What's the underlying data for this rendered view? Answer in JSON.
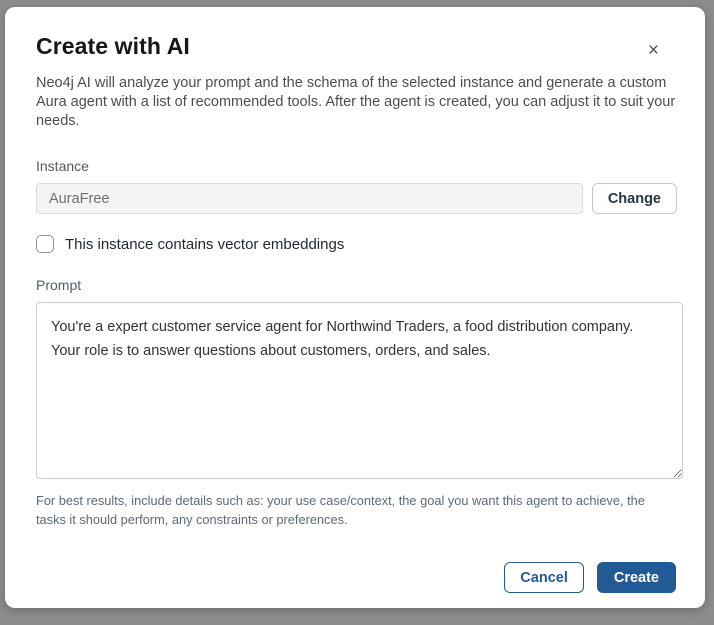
{
  "modal": {
    "title": "Create with AI",
    "close_icon": "×",
    "description": "Neo4j AI will analyze your prompt and the schema of the selected instance and generate a custom Aura agent with a list of recommended tools. After the agent is created, you can adjust it to suit your needs.",
    "instance": {
      "label": "Instance",
      "value": "AuraFree",
      "change_button_label": "Change"
    },
    "vector_checkbox": {
      "label": "This instance contains vector embeddings",
      "checked": false
    },
    "prompt": {
      "label": "Prompt",
      "value": "You're a expert customer service agent for Northwind Traders, a food distribution company.\nYour role is to answer questions about customers, orders, and sales.",
      "helper": "For best results, include details such as: your use case/context, the goal you want this agent to achieve, the tasks it should perform, any constraints or preferences."
    },
    "footer": {
      "cancel_label": "Cancel",
      "create_label": "Create"
    },
    "colors": {
      "accent_blue": "#215a94",
      "backdrop_gray": "#8d8d8d",
      "input_disabled_bg": "#f4f4f4"
    }
  }
}
